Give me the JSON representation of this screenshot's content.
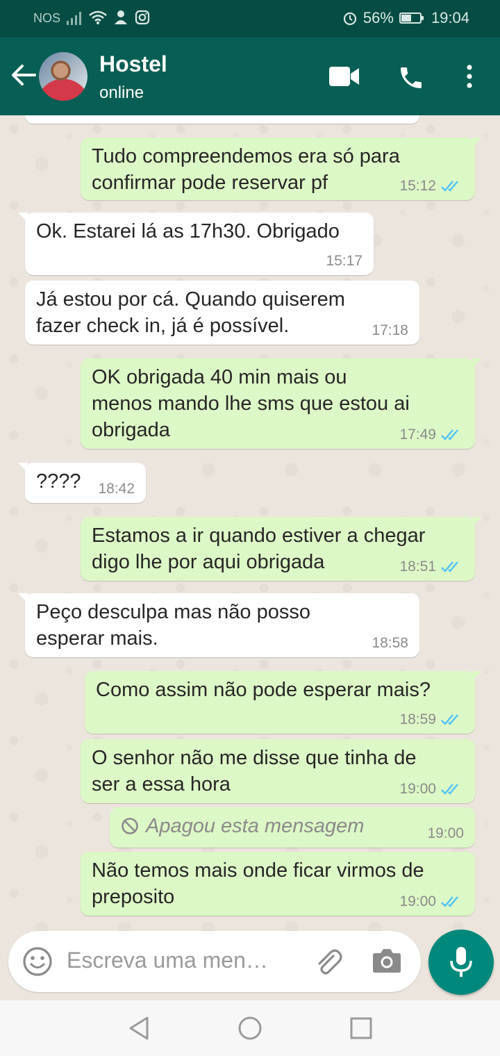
{
  "status_bar": {
    "carrier": "NOS",
    "battery": "56%",
    "battery_level": 0.56,
    "time": "19:04"
  },
  "header": {
    "contact_name": "Hostel",
    "contact_status": "online",
    "icons": [
      "back-arrow-icon",
      "avatar",
      "video-call-icon",
      "phone-icon",
      "more-vert-icon"
    ]
  },
  "messages": [
    {
      "dir": "out",
      "text": "Tudo compreendemos era só para\nconfirmar pode reservar pf",
      "time": "15:12",
      "status": "read"
    },
    {
      "dir": "in",
      "text": "Ok. Estarei lá as 17h30. Obrigado",
      "time": "15:17"
    },
    {
      "dir": "in",
      "text": "Já estou por cá. Quando quiserem\nfazer check in, já é possível.",
      "time": "17:18"
    },
    {
      "dir": "out",
      "text": "OK obrigada 40 min mais ou\nmenos mando lhe sms que estou ai\nobrigada",
      "time": "17:49",
      "status": "read"
    },
    {
      "dir": "in",
      "text": "????",
      "time": "18:42"
    },
    {
      "dir": "out",
      "text": "Estamos a ir quando estiver a chegar\ndigo lhe por aqui obrigada",
      "time": "18:51",
      "status": "read"
    },
    {
      "dir": "in",
      "text": "Peço desculpa mas não posso\nesperar mais.",
      "time": "18:58"
    },
    {
      "dir": "out",
      "text": "Como assim não pode esperar mais?",
      "time": "18:59",
      "status": "read"
    },
    {
      "dir": "out",
      "text": "O senhor não me disse que tinha de\nser a essa hora",
      "time": "19:00",
      "status": "read"
    },
    {
      "dir": "out",
      "text": "Apagou esta mensagem",
      "time": "19:00",
      "deleted": true
    },
    {
      "dir": "out",
      "text": "Não temos mais onde ficar virmos de\npreposito",
      "time": "19:00",
      "status": "read"
    }
  ],
  "composer": {
    "placeholder": "Escreva uma men…"
  },
  "colors": {
    "header": "#075e54",
    "status_bar": "#054d44",
    "outgoing_bubble": "#dcf8c6",
    "incoming_bubble": "#ffffff",
    "read_ticks": "#4fc3f7",
    "mic_button": "#00897b"
  }
}
